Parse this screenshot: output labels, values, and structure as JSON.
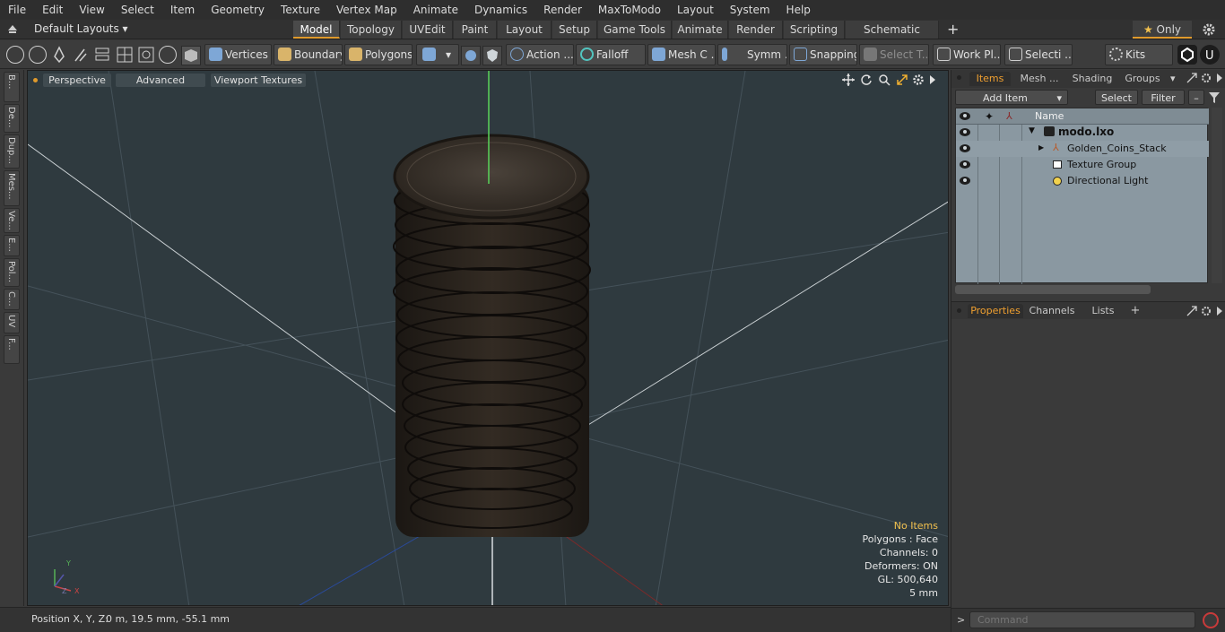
{
  "menu": [
    "File",
    "Edit",
    "View",
    "Select",
    "Item",
    "Geometry",
    "Texture",
    "Vertex Map",
    "Animate",
    "Dynamics",
    "Render",
    "MaxToModo",
    "Layout",
    "System",
    "Help"
  ],
  "layout_bar": {
    "layout_selector": "Default Layouts",
    "tabs": [
      "Model",
      "Topology",
      "UVEdit",
      "Paint",
      "Layout",
      "Setup",
      "Game Tools",
      "Animate",
      "Render",
      "Scripting",
      "Schematic Fusion"
    ],
    "active_tab": "Model",
    "add_tab_symbol": "+",
    "only_label": "Only",
    "star_symbol": "★"
  },
  "toolbar": {
    "vertices": "Vertices",
    "boundary": "Boundary",
    "polygons": "Polygons",
    "action": "Action ...",
    "falloff": "Falloff",
    "mesh_c": "Mesh C ...",
    "symm": "Symm ...",
    "snapping": "Snapping",
    "select_t": "Select T...",
    "work_pl": "Work Pl...",
    "selecti": "Selecti ...",
    "kits": "Kits"
  },
  "left_tabs": [
    "B...",
    "De...",
    "Dup...",
    "Mes...",
    "Ve...",
    "E...",
    "Pol...",
    "C...",
    "UV",
    "F..."
  ],
  "viewport": {
    "perspective": "Perspective",
    "advanced": "Advanced",
    "viewport_textures": "Viewport Textures",
    "stats": {
      "no_items": "No Items",
      "polygons": "Polygons : Face",
      "channels": "Channels: 0",
      "deformers": "Deformers: ON",
      "gl": "GL: 500,640",
      "scale": "5 mm"
    },
    "axis_labels": {
      "x": "X",
      "y": "Y",
      "z": "Z"
    }
  },
  "status": {
    "label": "Position X, Y, Z:",
    "value": "0 m, 19.5 mm, -55.1 mm"
  },
  "right_panel": {
    "tabs": [
      "Items",
      "Mesh ...",
      "Shading",
      "Groups"
    ],
    "active_tab": "Items",
    "add_item": "Add Item",
    "select": "Select",
    "filter": "Filter",
    "column_name": "Name",
    "items": [
      {
        "name": "modo.lxo",
        "icon": "scene-icon",
        "bold": true
      },
      {
        "name": "Golden_Coins_Stack",
        "icon": "mesh-icon",
        "bold": false
      },
      {
        "name": "Texture Group",
        "icon": "texture-group-icon",
        "bold": false
      },
      {
        "name": "Directional Light",
        "icon": "light-icon",
        "bold": false
      }
    ],
    "bottom_tabs": [
      "Properties",
      "Channels",
      "Lists"
    ],
    "bottom_active": "Properties",
    "bottom_add": "+"
  },
  "command": {
    "prompt": ">",
    "placeholder": "Command"
  },
  "colors": {
    "accent": "#e09a2c",
    "viewport_bg": "#2f3a3f",
    "item_list_bg": "#8a98a1",
    "coin": "#2a241e"
  }
}
